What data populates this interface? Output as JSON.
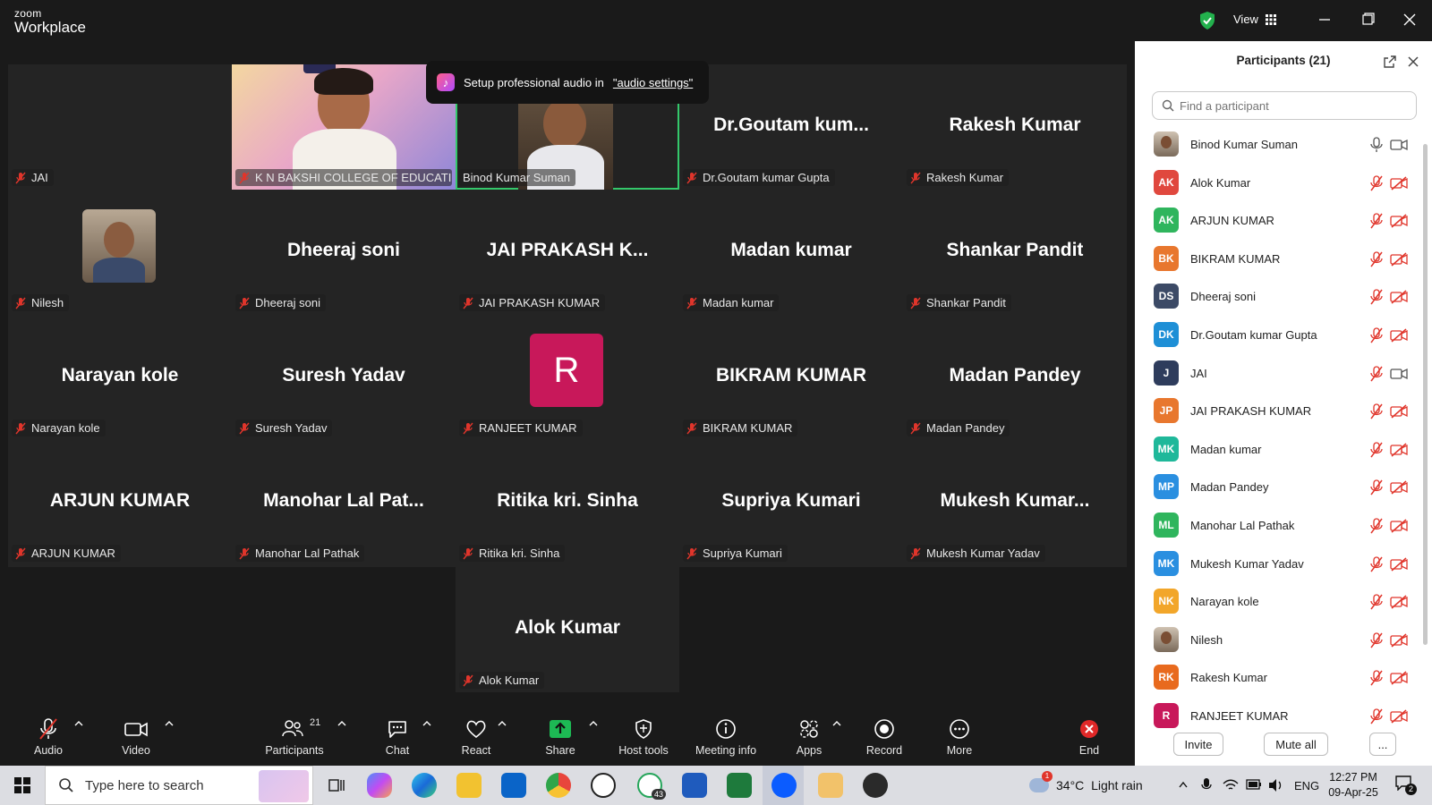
{
  "app": {
    "brand_small": "zoom",
    "brand_large": "Workplace",
    "view_label": "View"
  },
  "toast": {
    "text": "Setup professional audio in",
    "link": "\"audio settings\""
  },
  "colors": {
    "active_speaker": "#34c86b",
    "muted_red": "#e0352b",
    "share_green": "#1db954",
    "end_red": "#e02828",
    "tile_bg": "#242424"
  },
  "tiles": [
    {
      "id": "jai",
      "display": "",
      "label": "JAI"
    },
    {
      "id": "knb",
      "display": "",
      "label": "K N BAKSHI COLLEGE OF EDUCATIO..."
    },
    {
      "id": "binod",
      "display": "",
      "label": "Binod Kumar Suman"
    },
    {
      "id": "goutam",
      "display": "Dr.Goutam kum...",
      "label": "Dr.Goutam kumar Gupta"
    },
    {
      "id": "rakesh",
      "display": "Rakesh Kumar",
      "label": "Rakesh Kumar"
    },
    {
      "id": "nilesh",
      "display": "",
      "label": "Nilesh"
    },
    {
      "id": "dheeraj",
      "display": "Dheeraj soni",
      "label": "Dheeraj soni"
    },
    {
      "id": "jaip",
      "display": "JAI PRAKASH K...",
      "label": "JAI PRAKASH KUMAR"
    },
    {
      "id": "madank",
      "display": "Madan kumar",
      "label": "Madan kumar"
    },
    {
      "id": "shankar",
      "display": "Shankar Pandit",
      "label": "Shankar Pandit"
    },
    {
      "id": "narayan",
      "display": "Narayan kole",
      "label": "Narayan kole"
    },
    {
      "id": "suresh",
      "display": "Suresh Yadav",
      "label": "Suresh Yadav"
    },
    {
      "id": "ranjeet",
      "display": "R",
      "label": "RANJEET KUMAR"
    },
    {
      "id": "bikram",
      "display": "BIKRAM KUMAR",
      "label": "BIKRAM KUMAR"
    },
    {
      "id": "madanp",
      "display": "Madan Pandey",
      "label": "Madan Pandey"
    },
    {
      "id": "arjun",
      "display": "ARJUN KUMAR",
      "label": "ARJUN KUMAR"
    },
    {
      "id": "manohar",
      "display": "Manohar Lal Pat...",
      "label": "Manohar Lal Pathak"
    },
    {
      "id": "ritika",
      "display": "Ritika kri. Sinha",
      "label": "Ritika kri. Sinha"
    },
    {
      "id": "supriya",
      "display": "Supriya Kumari",
      "label": "Supriya Kumari"
    },
    {
      "id": "mukesh",
      "display": "Mukesh Kumar...",
      "label": "Mukesh Kumar Yadav"
    },
    {
      "id": "alok",
      "display": "Alok Kumar",
      "label": "Alok Kumar"
    }
  ],
  "toolbar": {
    "audio": "Audio",
    "video": "Video",
    "participants": "Participants",
    "participants_count": "21",
    "chat": "Chat",
    "react": "React",
    "share": "Share",
    "host_tools": "Host tools",
    "meeting_info": "Meeting info",
    "apps": "Apps",
    "record": "Record",
    "more": "More",
    "end": "End"
  },
  "panel": {
    "title": "Participants (21)",
    "search_placeholder": "Find a participant",
    "invite": "Invite",
    "mute_all": "Mute all",
    "more": "...",
    "participants": [
      {
        "initials": "",
        "name": "Binod Kumar Suman",
        "color": "#8a8a8a",
        "photo": true,
        "mic_on": true,
        "cam_on": true
      },
      {
        "initials": "AK",
        "name": "Alok Kumar",
        "color": "#e0483e",
        "mic_on": false,
        "cam_on": false
      },
      {
        "initials": "AK",
        "name": "ARJUN KUMAR",
        "color": "#2fb55d",
        "mic_on": false,
        "cam_on": false
      },
      {
        "initials": "BK",
        "name": "BIKRAM KUMAR",
        "color": "#e8772e",
        "mic_on": false,
        "cam_on": false
      },
      {
        "initials": "DS",
        "name": "Dheeraj soni",
        "color": "#3c4a66",
        "mic_on": false,
        "cam_on": false
      },
      {
        "initials": "DK",
        "name": "Dr.Goutam kumar Gupta",
        "color": "#1e8fd6",
        "mic_on": false,
        "cam_on": false
      },
      {
        "initials": "J",
        "name": "JAI",
        "color": "#2e3c5c",
        "mic_on": false,
        "cam_on": true
      },
      {
        "initials": "JP",
        "name": "JAI PRAKASH KUMAR",
        "color": "#e8772e",
        "mic_on": false,
        "cam_on": false
      },
      {
        "initials": "MK",
        "name": "Madan kumar",
        "color": "#1fb89a",
        "mic_on": false,
        "cam_on": false
      },
      {
        "initials": "MP",
        "name": "Madan Pandey",
        "color": "#2a8fe0",
        "mic_on": false,
        "cam_on": false
      },
      {
        "initials": "ML",
        "name": "Manohar Lal Pathak",
        "color": "#2fb55d",
        "mic_on": false,
        "cam_on": false
      },
      {
        "initials": "MK",
        "name": "Mukesh Kumar Yadav",
        "color": "#2a8fe0",
        "mic_on": false,
        "cam_on": false
      },
      {
        "initials": "NK",
        "name": "Narayan kole",
        "color": "#f2a62a",
        "mic_on": false,
        "cam_on": false
      },
      {
        "initials": "",
        "name": "Nilesh",
        "color": "#8a7a6a",
        "photo": true,
        "mic_on": false,
        "cam_on": false
      },
      {
        "initials": "RK",
        "name": "Rakesh Kumar",
        "color": "#e86a1e",
        "mic_on": false,
        "cam_on": false
      },
      {
        "initials": "R",
        "name": "RANJEET KUMAR",
        "color": "#c8185a",
        "mic_on": false,
        "cam_on": false
      }
    ]
  },
  "taskbar": {
    "search_placeholder": "Type here to search",
    "weather_temp": "34°C",
    "weather_text": "Light rain",
    "lang": "ENG",
    "time": "12:27 PM",
    "date": "09-Apr-25",
    "notif_count": "2",
    "weather_badge": "1",
    "whatsapp_badge": "43"
  }
}
